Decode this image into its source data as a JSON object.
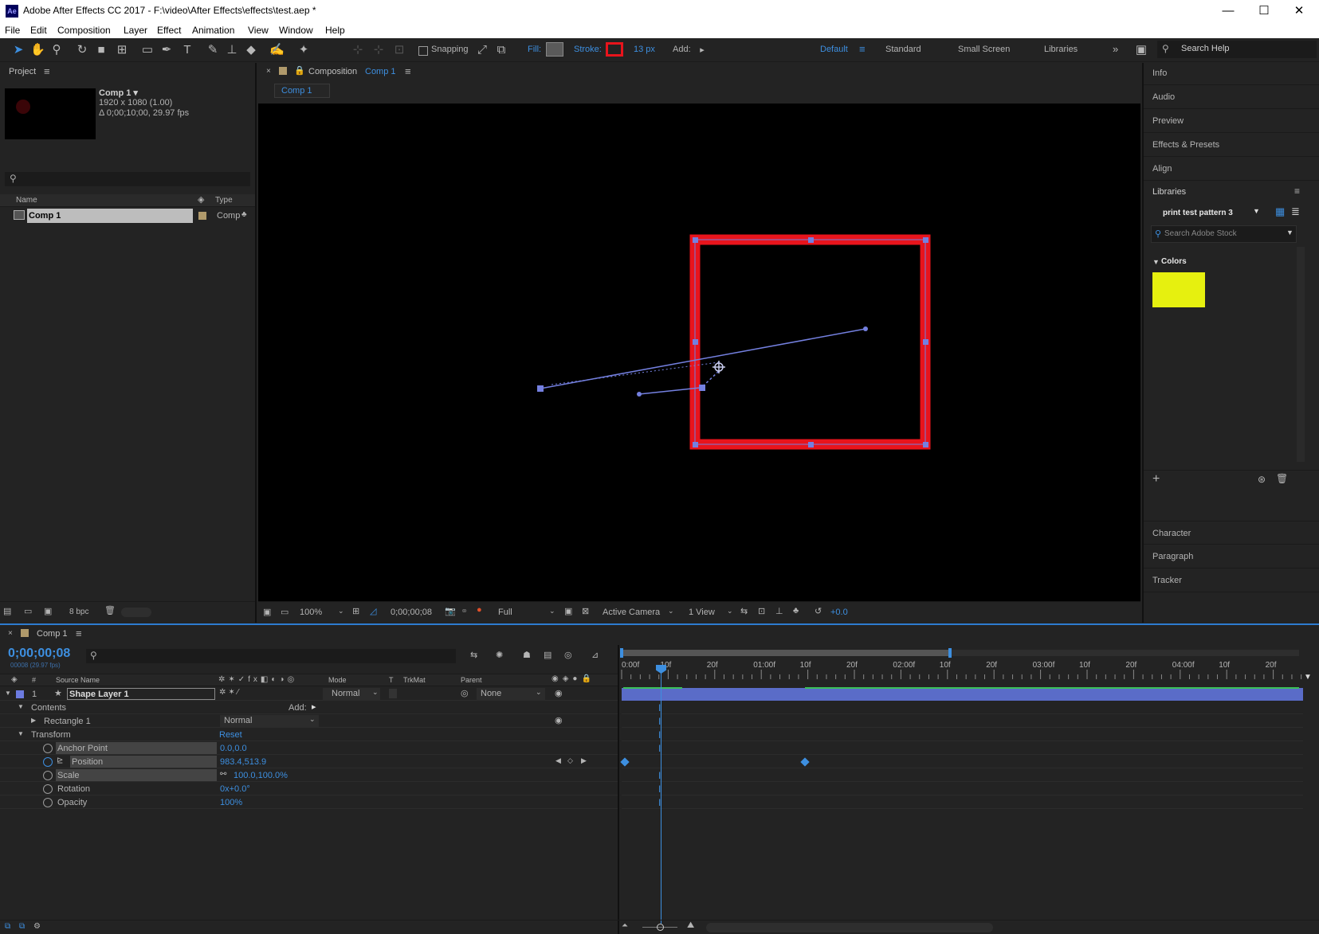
{
  "app": {
    "title": "Adobe After Effects CC 2017 - F:\\video\\After Effects\\effects\\test.aep *",
    "logo": "Ae"
  },
  "window_controls": {
    "minimize": "—",
    "maximize": "☐",
    "close": "✕"
  },
  "menu": [
    "File",
    "Edit",
    "Composition",
    "Layer",
    "Effect",
    "Animation",
    "View",
    "Window",
    "Help"
  ],
  "toolbar": {
    "snapping_label": "Snapping",
    "fill_label": "Fill:",
    "stroke_label": "Stroke:",
    "stroke_width": "13 px",
    "add_label": "Add:",
    "workspaces": [
      "Default",
      "Standard",
      "Small Screen",
      "Libraries"
    ],
    "search_help": "Search Help"
  },
  "project": {
    "header": "Project",
    "comp_name": "Comp 1 ▾",
    "comp_size": "1920 x 1080 (1.00)",
    "comp_duration": "Δ 0;00;10;00, 29.97 fps",
    "col_name": "Name",
    "col_type": "Type",
    "item_name": "Comp 1",
    "item_type": "Comp",
    "bpc": "8 bpc"
  },
  "viewer": {
    "tab_prefix": "Composition",
    "tab_comp": "Comp 1",
    "subtab": "Comp 1",
    "zoom": "100%",
    "timecode": "0;00;00;08",
    "resolution": "Full",
    "camera": "Active Camera",
    "views": "1 View",
    "exposure": "+0.0"
  },
  "right_panels": {
    "items_top": [
      "Info",
      "Audio",
      "Preview",
      "Effects & Presets",
      "Align"
    ],
    "libraries_header": "Libraries",
    "library_name": "print test pattern 3",
    "stock_search": "Search Adobe Stock",
    "colors_label": "Colors",
    "swatch_color": "#e6f00f",
    "items_bottom": [
      "Character",
      "Paragraph",
      "Tracker"
    ]
  },
  "timeline": {
    "tab": "Comp 1",
    "timecode": "0;00;00;08",
    "frame_info": "00008 (29.97 fps)",
    "col_source": "Source Name",
    "col_mode": "Mode",
    "col_t": "T",
    "col_trkmat": "TrkMat",
    "col_parent": "Parent",
    "layer_index": "1",
    "layer_name": "Shape Layer 1",
    "layer_mode": "Normal",
    "layer_parent": "None",
    "contents": "Contents",
    "add_label": "Add:",
    "rectangle": "Rectangle 1",
    "rect_mode": "Normal",
    "transform": "Transform",
    "reset": "Reset",
    "props": [
      {
        "name": "Anchor Point",
        "value": "0.0,0.0"
      },
      {
        "name": "Position",
        "value": "983.4,513.9"
      },
      {
        "name": "Scale",
        "value": "100.0,100.0%"
      },
      {
        "name": "Rotation",
        "value": "0x+0.0°"
      },
      {
        "name": "Opacity",
        "value": "100%"
      }
    ],
    "ruler": [
      "0:00f",
      "10f",
      "20f",
      "01:00f",
      "10f",
      "20f",
      "02:00f",
      "10f",
      "20f",
      "03:00f",
      "10f",
      "20f",
      "04:00f",
      "10f",
      "20f"
    ]
  },
  "colors": {
    "accent": "#3d8fe0",
    "stroke_red": "#e8141c",
    "layer_bar": "#5a6cc8",
    "path_blue": "#7480e0"
  }
}
